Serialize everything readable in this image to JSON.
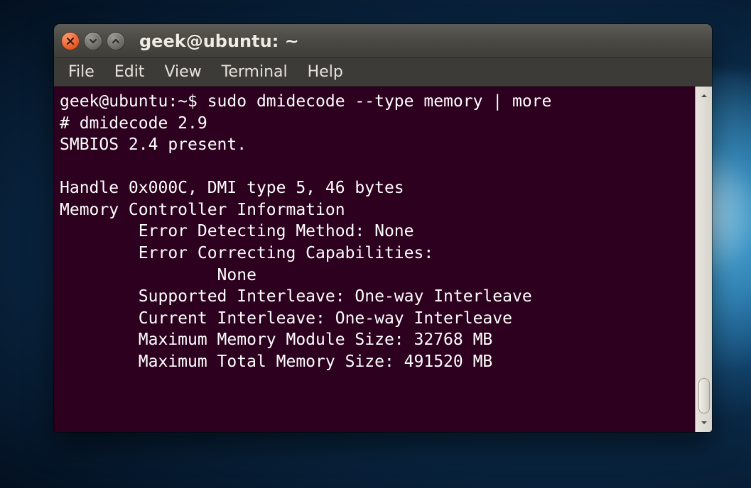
{
  "window": {
    "title": "geek@ubuntu: ~"
  },
  "menu": {
    "file": "File",
    "edit": "Edit",
    "view": "View",
    "terminal": "Terminal",
    "help": "Help"
  },
  "terminal": {
    "prompt": "geek@ubuntu:~$ ",
    "command": "sudo dmidecode --type memory | more",
    "output_lines": [
      "# dmidecode 2.9",
      "SMBIOS 2.4 present.",
      "",
      "Handle 0x000C, DMI type 5, 46 bytes",
      "Memory Controller Information",
      "        Error Detecting Method: None",
      "        Error Correcting Capabilities:",
      "                None",
      "        Supported Interleave: One-way Interleave",
      "        Current Interleave: One-way Interleave",
      "        Maximum Memory Module Size: 32768 MB",
      "        Maximum Total Memory Size: 491520 MB"
    ]
  }
}
